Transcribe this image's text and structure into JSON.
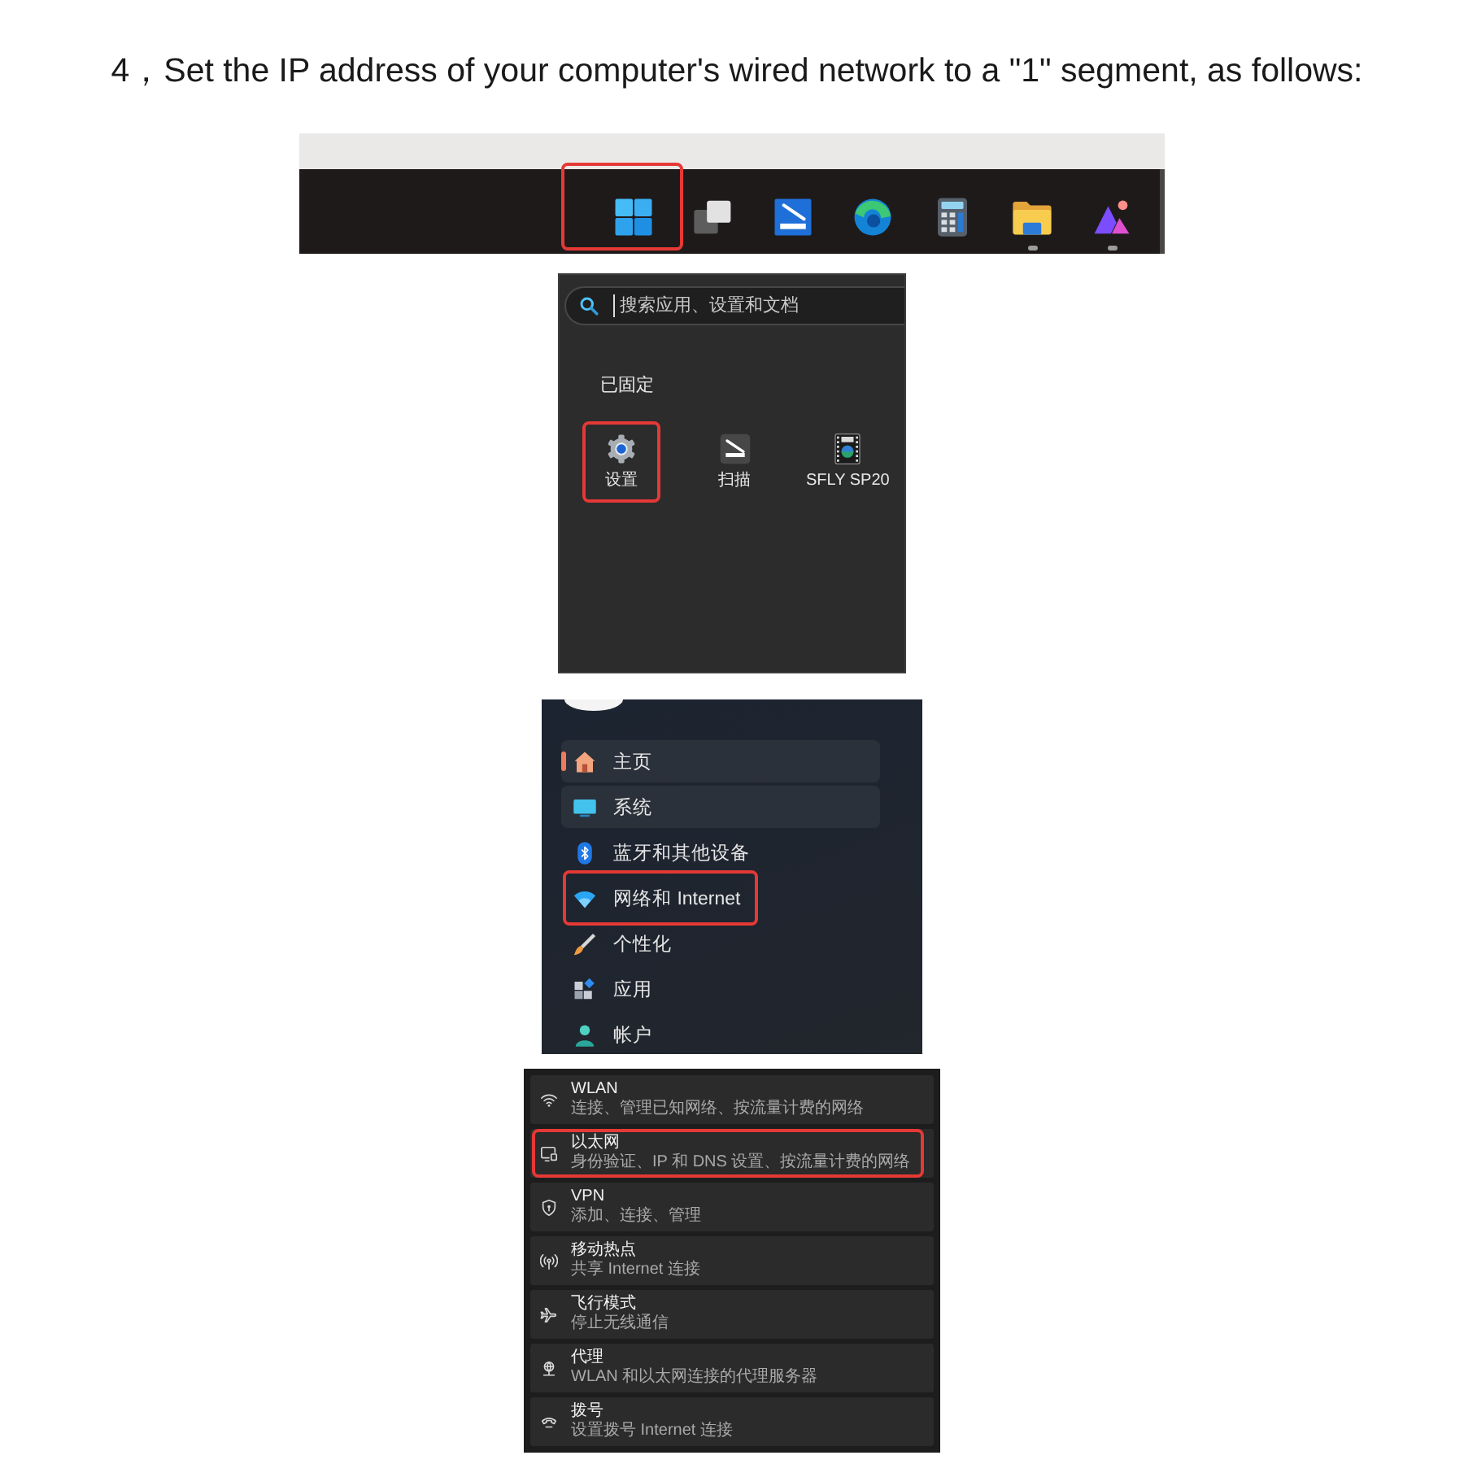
{
  "instruction": "4，Set the IP address of your computer's wired network to a \"1\" segment, as follows:",
  "taskbar": {
    "icons": [
      {
        "running": false,
        "annotated": true
      },
      {
        "running": false,
        "annotated": false
      },
      {
        "running": false,
        "annotated": false
      },
      {
        "running": false,
        "annotated": false
      },
      {
        "running": false,
        "annotated": false
      },
      {
        "running": true,
        "annotated": false
      },
      {
        "running": true,
        "annotated": false
      }
    ]
  },
  "start_menu": {
    "search": {
      "placeholder": "搜索应用、设置和文档"
    },
    "pinned_heading": "已固定",
    "pinned_apps": [
      {
        "label": "设置",
        "annotated": true
      },
      {
        "label": "扫描",
        "annotated": false
      },
      {
        "label": "SFLY SP20",
        "annotated": false
      }
    ]
  },
  "settings_sidebar": {
    "items": [
      {
        "label": "主页",
        "selected": true,
        "hovered": false,
        "annotated": false
      },
      {
        "label": "系统",
        "selected": false,
        "hovered": true,
        "annotated": false
      },
      {
        "label": "蓝牙和其他设备",
        "selected": false,
        "hovered": false,
        "annotated": false
      },
      {
        "label": "网络和 Internet",
        "selected": false,
        "hovered": false,
        "annotated": true
      },
      {
        "label": "个性化",
        "selected": false,
        "hovered": false,
        "annotated": false
      },
      {
        "label": "应用",
        "selected": false,
        "hovered": false,
        "annotated": false
      },
      {
        "label": "帐户",
        "selected": false,
        "hovered": false,
        "annotated": false
      }
    ]
  },
  "network_settings": {
    "rows": [
      {
        "title": "WLAN",
        "subtitle": "连接、管理已知网络、按流量计费的网络",
        "annotated": false
      },
      {
        "title": "以太网",
        "subtitle": "身份验证、IP 和 DNS 设置、按流量计费的网络",
        "annotated": true
      },
      {
        "title": "VPN",
        "subtitle": "添加、连接、管理",
        "annotated": false
      },
      {
        "title": "移动热点",
        "subtitle": "共享 Internet 连接",
        "annotated": false
      },
      {
        "title": "飞行模式",
        "subtitle": "停止无线通信",
        "annotated": false
      },
      {
        "title": "代理",
        "subtitle": "WLAN 和以太网连接的代理服务器",
        "annotated": false
      },
      {
        "title": "拨号",
        "subtitle": "设置拨号 Internet 连接",
        "annotated": false
      }
    ]
  }
}
